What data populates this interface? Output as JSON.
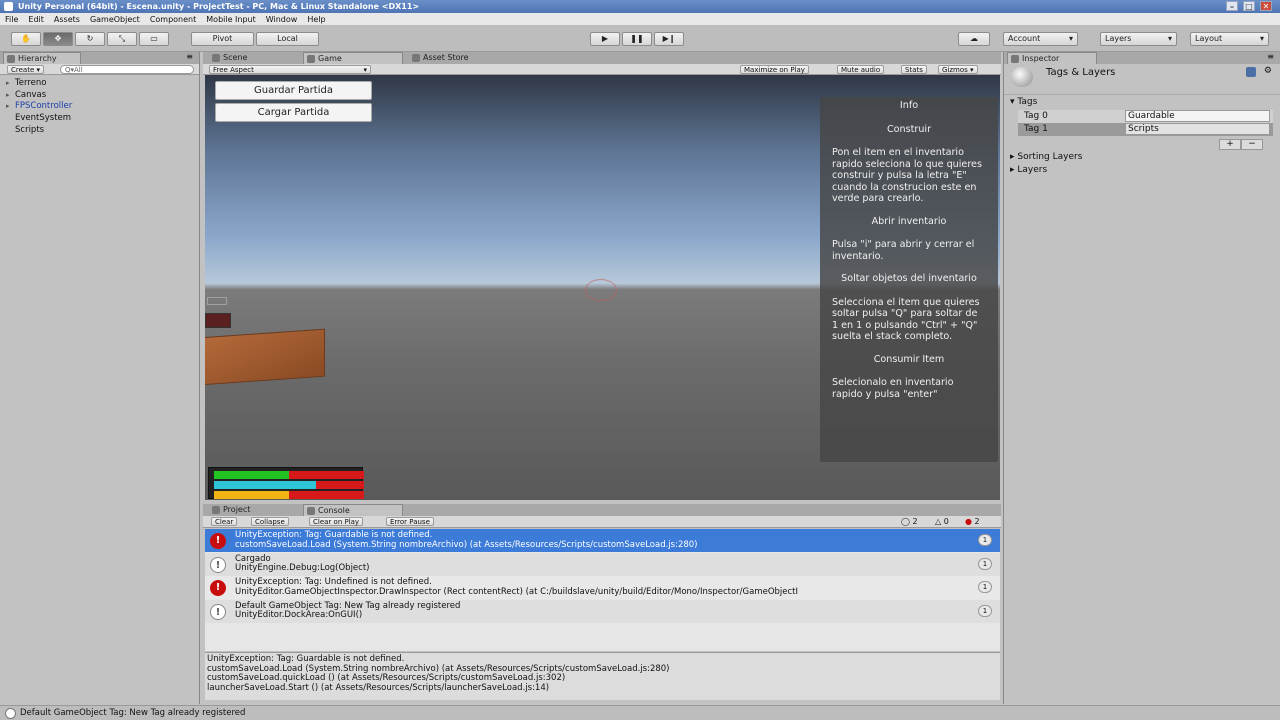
{
  "window": {
    "title": "Unity Personal (64bit) - Escena.unity - ProjectTest - PC, Mac & Linux Standalone <DX11>"
  },
  "menu": [
    "File",
    "Edit",
    "Assets",
    "GameObject",
    "Component",
    "Mobile Input",
    "Window",
    "Help"
  ],
  "toolbar": {
    "pivot": "Pivot",
    "local": "Local",
    "account": "Account",
    "layers": "Layers",
    "layout": "Layout"
  },
  "hierarchy": {
    "tab": "Hierarchy",
    "create": "Create",
    "search_placeholder": "Q▾All",
    "items": [
      {
        "label": "Terreno",
        "expandable": true
      },
      {
        "label": "Canvas",
        "expandable": true
      },
      {
        "label": "FPSController",
        "expandable": true,
        "color": "#1d3fa8"
      },
      {
        "label": "EventSystem",
        "expandable": false
      },
      {
        "label": "Scripts",
        "expandable": false
      }
    ]
  },
  "game": {
    "tabs": [
      "Scene",
      "Game",
      "Asset Store"
    ],
    "aspect": "Free Aspect",
    "options": [
      "Maximize on Play",
      "Mute audio",
      "Stats",
      "Gizmos"
    ],
    "buttons": {
      "save": "Guardar Partida",
      "load": "Cargar Partida"
    },
    "info": {
      "title": "Info",
      "sections": [
        {
          "heading": "Construir",
          "text": "Pon el item en el inventario rapido seleciona lo que quieres construir y pulsa la letra \"E\" cuando la construcion este en verde para crearlo."
        },
        {
          "heading": "Abrir inventario",
          "text": "Pulsa \"i\" para abrir y cerrar el inventario."
        },
        {
          "heading": "Soltar objetos del inventario",
          "text": "Selecciona el item que quieres soltar  pulsa \"Q\" para soltar de 1 en 1 o pulsando \"Ctrl\" + \"Q\" suelta el stack completo."
        },
        {
          "heading": "Consumir Item",
          "text": "Selecionalo en inventario rapido y pulsa \"enter\""
        }
      ]
    },
    "bars": [
      {
        "fill": 0.5,
        "color": "#22c322"
      },
      {
        "fill": 0.68,
        "color": "#2fc5d8"
      },
      {
        "fill": 0.5,
        "color": "#f0b414"
      }
    ]
  },
  "console": {
    "tabs": [
      "Project",
      "Console"
    ],
    "buttons": [
      "Clear",
      "Collapse",
      "Clear on Play",
      "Error Pause"
    ],
    "counts": {
      "info": "2",
      "warn": "0",
      "error": "2"
    },
    "entries": [
      {
        "type": "error",
        "line1": "UnityException: Tag: Guardable is not defined.",
        "line2": "customSaveLoad.Load (System.String nombreArchivo) (at Assets/Resources/Scripts/customSaveLoad.js:280)",
        "count": "1",
        "selected": true
      },
      {
        "type": "info",
        "line1": "Cargado",
        "line2": "UnityEngine.Debug:Log(Object)",
        "count": "1",
        "selected": false
      },
      {
        "type": "error",
        "line1": "UnityException: Tag: Undefined is not defined.",
        "line2": "UnityEditor.GameObjectInspector.DrawInspector (Rect contentRect) (at C:/buildslave/unity/build/Editor/Mono/Inspector/GameObjectI",
        "count": "1",
        "selected": false
      },
      {
        "type": "info",
        "line1": "Default GameObject Tag: New Tag already registered",
        "line2": "UnityEditor.DockArea:OnGUI()",
        "count": "1",
        "selected": false
      }
    ],
    "detail": "UnityException: Tag: Guardable is not defined.\ncustomSaveLoad.Load (System.String nombreArchivo) (at Assets/Resources/Scripts/customSaveLoad.js:280)\ncustomSaveLoad.quickLoad () (at Assets/Resources/Scripts/customSaveLoad.js:302)\nlauncherSaveLoad.Start () (at Assets/Resources/Scripts/launcherSaveLoad.js:14)"
  },
  "inspector": {
    "tab": "Inspector",
    "title": "Tags & Layers",
    "tags_label": "Tags",
    "tags": [
      {
        "name": "Tag 0",
        "value": "Guardable"
      },
      {
        "name": "Tag 1",
        "value": "Scripts"
      }
    ],
    "sorting_layers": "Sorting Layers",
    "layers": "Layers"
  },
  "status": "Default GameObject Tag: New Tag already registered"
}
